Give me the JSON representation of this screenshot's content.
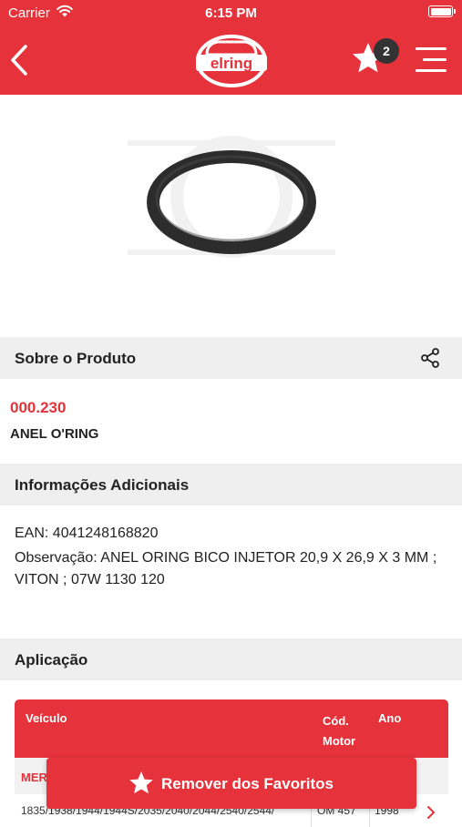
{
  "status_bar": {
    "carrier": "Carrier",
    "time": "6:15 PM"
  },
  "nav": {
    "logo_text": "elring",
    "favorites_count": "2"
  },
  "about": {
    "title": "Sobre o Produto",
    "code": "000.230",
    "name": "ANEL O'RING"
  },
  "additional": {
    "title": "Informações Adicionais",
    "ean": "EAN: 4041248168820",
    "note": "Observação: ANEL ORING BICO INJETOR 20,9 X 26,9 X 3 MM ; VITON ; 07W 1130 120"
  },
  "application": {
    "title": "Aplicação",
    "columns": [
      "Veículo",
      "Cód. Motor",
      "Ano"
    ],
    "group": "MERCEDES",
    "row": {
      "vehicle": "1835/1938/1944/1944S/2035/2040/2044/2540/2544/",
      "engine": "OM 457",
      "year": "1998"
    }
  },
  "actions": {
    "remove_favorites": "Remover dos Favoritos"
  },
  "colors": {
    "brand": "#e5323b",
    "section_bg": "#efefef",
    "badge": "#333333"
  },
  "icons": [
    "wifi-icon",
    "battery-icon",
    "back-icon",
    "star-icon",
    "menu-icon",
    "share-icon",
    "chevron-right-icon"
  ]
}
